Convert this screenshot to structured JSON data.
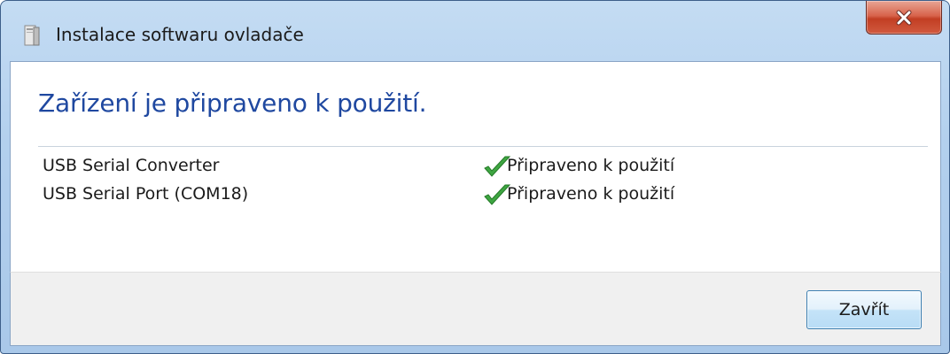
{
  "window": {
    "title": "Instalace softwaru ovladače",
    "title_icon": "device-setup-icon",
    "close_icon": "close-icon",
    "close_button_color": "#c23e23"
  },
  "main": {
    "heading": "Zařízení je připraveno k použití.",
    "heading_color": "#1f48a0",
    "devices": [
      {
        "name": "USB Serial Converter",
        "status": "Připraveno k použití",
        "status_icon": "checkmark-icon"
      },
      {
        "name": "USB Serial Port (COM18)",
        "status": "Připraveno k použití",
        "status_icon": "checkmark-icon"
      }
    ]
  },
  "footer": {
    "close_label": "Zavřít"
  }
}
